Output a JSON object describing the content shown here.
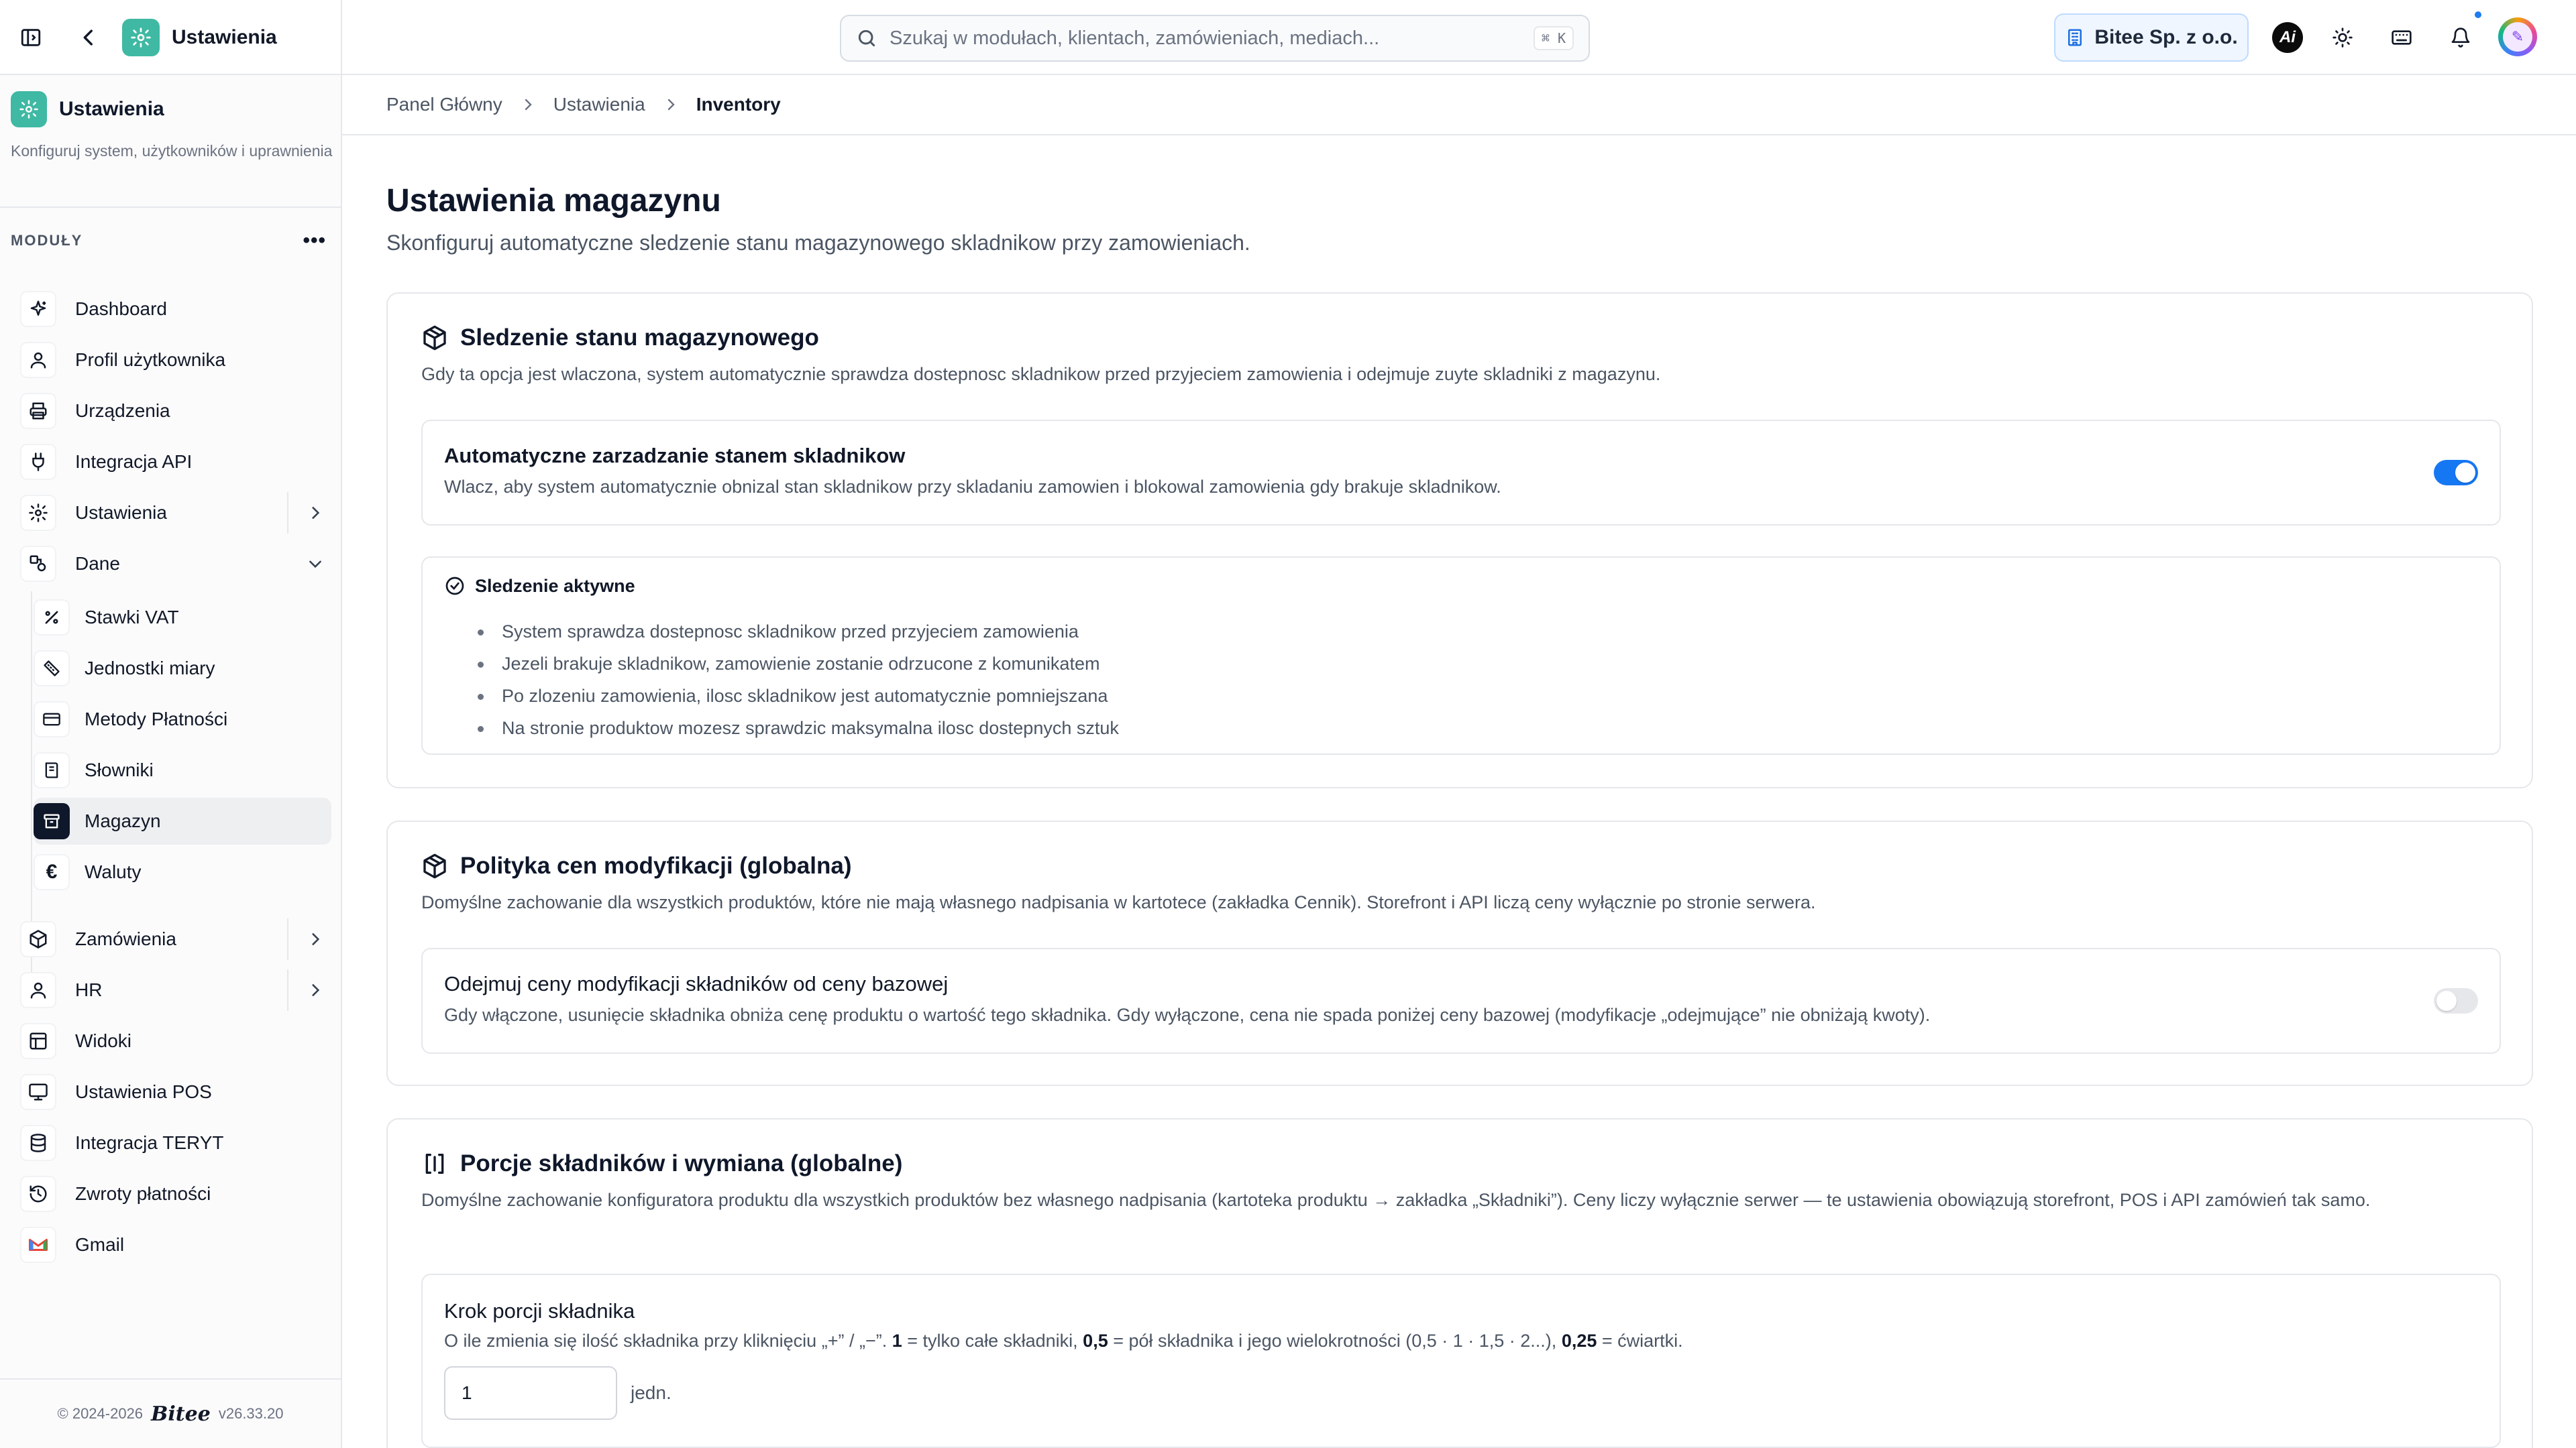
{
  "header": {
    "app_title": "Ustawienia",
    "search_placeholder": "Szukaj w modułach, klientach, zamówieniach, mediach...",
    "search_shortcut": "⌘ K",
    "company": "Bitee Sp. z o.o.",
    "ai_label": "Ai"
  },
  "sidebar": {
    "title": "Ustawienia",
    "description": "Konfiguruj system, użytkowników i uprawnienia",
    "section_label": "MODUŁY",
    "items": [
      {
        "label": "Dashboard",
        "icon": "sparkles-icon"
      },
      {
        "label": "Profil użytkownika",
        "icon": "user-icon"
      },
      {
        "label": "Urządzenia",
        "icon": "printer-icon"
      },
      {
        "label": "Integracja API",
        "icon": "plug-icon"
      },
      {
        "label": "Ustawienia",
        "icon": "gear-icon"
      },
      {
        "label": "Dane",
        "icon": "shapes-icon"
      }
    ],
    "sub_items": [
      {
        "label": "Stawki VAT",
        "icon": "percent-icon"
      },
      {
        "label": "Jednostki miary",
        "icon": "ruler-icon"
      },
      {
        "label": "Metody Płatności",
        "icon": "card-icon"
      },
      {
        "label": "Słowniki",
        "icon": "book-icon"
      },
      {
        "label": "Magazyn",
        "icon": "archive-icon"
      },
      {
        "label": "Waluty",
        "icon": "euro-icon"
      }
    ],
    "bottom_items": [
      {
        "label": "Zamówienia",
        "icon": "package-icon"
      },
      {
        "label": "HR",
        "icon": "user-icon"
      },
      {
        "label": "Widoki",
        "icon": "layout-icon"
      },
      {
        "label": "Ustawienia POS",
        "icon": "monitor-icon"
      },
      {
        "label": "Integracja TERYT",
        "icon": "database-icon"
      },
      {
        "label": "Zwroty płatności",
        "icon": "refund-icon"
      },
      {
        "label": "Gmail",
        "icon": "gmail-icon"
      }
    ],
    "footer_copyright": "© 2024-2026",
    "footer_brand": "Bitee",
    "footer_version": "v26.33.20"
  },
  "breadcrumb": {
    "items": [
      "Panel Główny",
      "Ustawienia"
    ],
    "current": "Inventory"
  },
  "page": {
    "title": "Ustawienia magazynu",
    "subtitle": "Skonfiguruj automatyczne sledzenie stanu magazynowego skladnikow przy zamowieniach."
  },
  "card_tracking": {
    "title": "Sledzenie stanu magazynowego",
    "description": "Gdy ta opcja jest wlaczona, system automatycznie sprawdza dostepnosc skladnikow przed przyjeciem zamowienia i odejmuje zuyte skladniki z magazynu.",
    "setting_title": "Automatyczne zarzadzanie stanem skladnikow",
    "setting_desc": "Wlacz, aby system automatycznie obnizal stan skladnikow przy skladaniu zamowien i blokowal zamowienia gdy brakuje skladnikow.",
    "toggle_on": true,
    "active_title": "Sledzenie aktywne",
    "active_points": [
      "System sprawdza dostepnosc skladnikow przed przyjeciem zamowienia",
      "Jezeli brakuje skladnikow, zamowienie zostanie odrzucone z komunikatem",
      "Po zlozeniu zamowienia, ilosc skladnikow jest automatycznie pomniejszana",
      "Na stronie produktow mozesz sprawdzic maksymalna ilosc dostepnych sztuk"
    ]
  },
  "card_pricing": {
    "title": "Polityka cen modyfikacji (globalna)",
    "description": "Domyślne zachowanie dla wszystkich produktów, które nie mają własnego nadpisania w kartotece (zakładka Cennik). Storefront i API liczą ceny wyłącznie po stronie serwera.",
    "setting_title": "Odejmuj ceny modyfikacji składników od ceny bazowej",
    "setting_desc": "Gdy włączone, usunięcie składnika obniża cenę produktu o wartość tego składnika. Gdy wyłączone, cena nie spada poniżej ceny bazowej (modyfikacje „odejmujące” nie obniżają kwoty).",
    "toggle_on": false
  },
  "card_portions": {
    "title": "Porcje składników i wymiana (globalne)",
    "description": "Domyślne zachowanie konfiguratora produktu dla wszystkich produktów bez własnego nadpisania (kartoteka produktu → zakładka „Składniki”). Ceny liczy wyłącznie serwer — te ustawienia obowiązują storefront, POS i API zamówień tak samo.",
    "step_title": "Krok porcji składnika",
    "step_desc_1": "O ile zmienia się ilość składnika przy kliknięciu „+” / „−”.",
    "step_val_1": "1",
    "step_desc_2": "= tylko całe składniki,",
    "step_val_2": "0,5",
    "step_desc_3": "= pół składnika i jego wielokrotności (0,5 · 1 · 1,5 · 2...),",
    "step_val_3": "0,25",
    "step_desc_4": "= ćwiartki.",
    "step_value": "1",
    "step_unit": "jedn."
  },
  "colors": {
    "accent": "#1677f3",
    "app_badge": "#3fb9a3",
    "active_nav": "#0f172a"
  }
}
